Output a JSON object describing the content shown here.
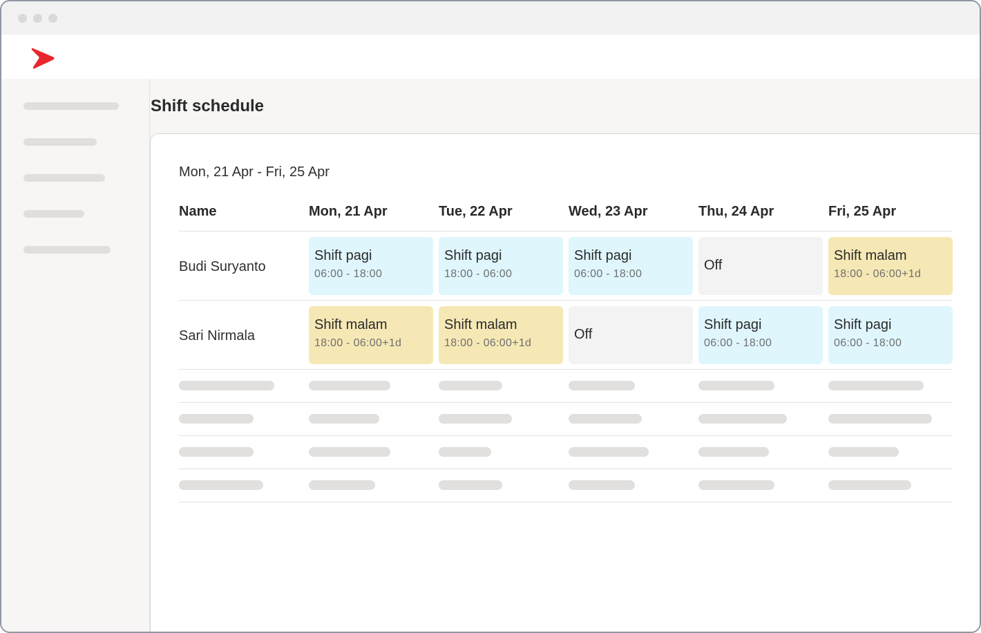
{
  "page": {
    "title": "Shift schedule"
  },
  "schedule": {
    "date_range": "Mon, 21 Apr - Fri, 25 Apr",
    "columns": [
      "Name",
      "Mon, 21 Apr",
      "Tue, 22 Apr",
      "Wed, 23 Apr",
      "Thu, 24 Apr",
      "Fri, 25 Apr"
    ],
    "rows": [
      {
        "name": "Budi Suryanto",
        "shifts": [
          {
            "label": "Shift pagi",
            "time": "06:00 - 18:00",
            "kind": "day"
          },
          {
            "label": "Shift pagi",
            "time": "18:00 - 06:00",
            "kind": "day"
          },
          {
            "label": "Shift pagi",
            "time": "06:00 - 18:00",
            "kind": "day"
          },
          {
            "label": "Off",
            "time": "",
            "kind": "off"
          },
          {
            "label": "Shift malam",
            "time": "18:00 - 06:00+1d",
            "kind": "night"
          }
        ]
      },
      {
        "name": "Sari Nirmala",
        "shifts": [
          {
            "label": "Shift malam",
            "time": "18:00 - 06:00+1d",
            "kind": "night"
          },
          {
            "label": "Shift malam",
            "time": "18:00 - 06:00+1d",
            "kind": "night"
          },
          {
            "label": "Off",
            "time": "",
            "kind": "off"
          },
          {
            "label": "Shift pagi",
            "time": "06:00 - 18:00",
            "kind": "day"
          },
          {
            "label": "Shift pagi",
            "time": "06:00 - 18:00",
            "kind": "day"
          }
        ]
      }
    ]
  },
  "colors": {
    "brand": "#e8262c",
    "day_shift": "#dff6fd",
    "night_shift": "#f6e8b5",
    "off": "#f3f3f3",
    "placeholder": "#e1e0de"
  },
  "icons": {
    "logo": "brand-chevron-logo"
  }
}
